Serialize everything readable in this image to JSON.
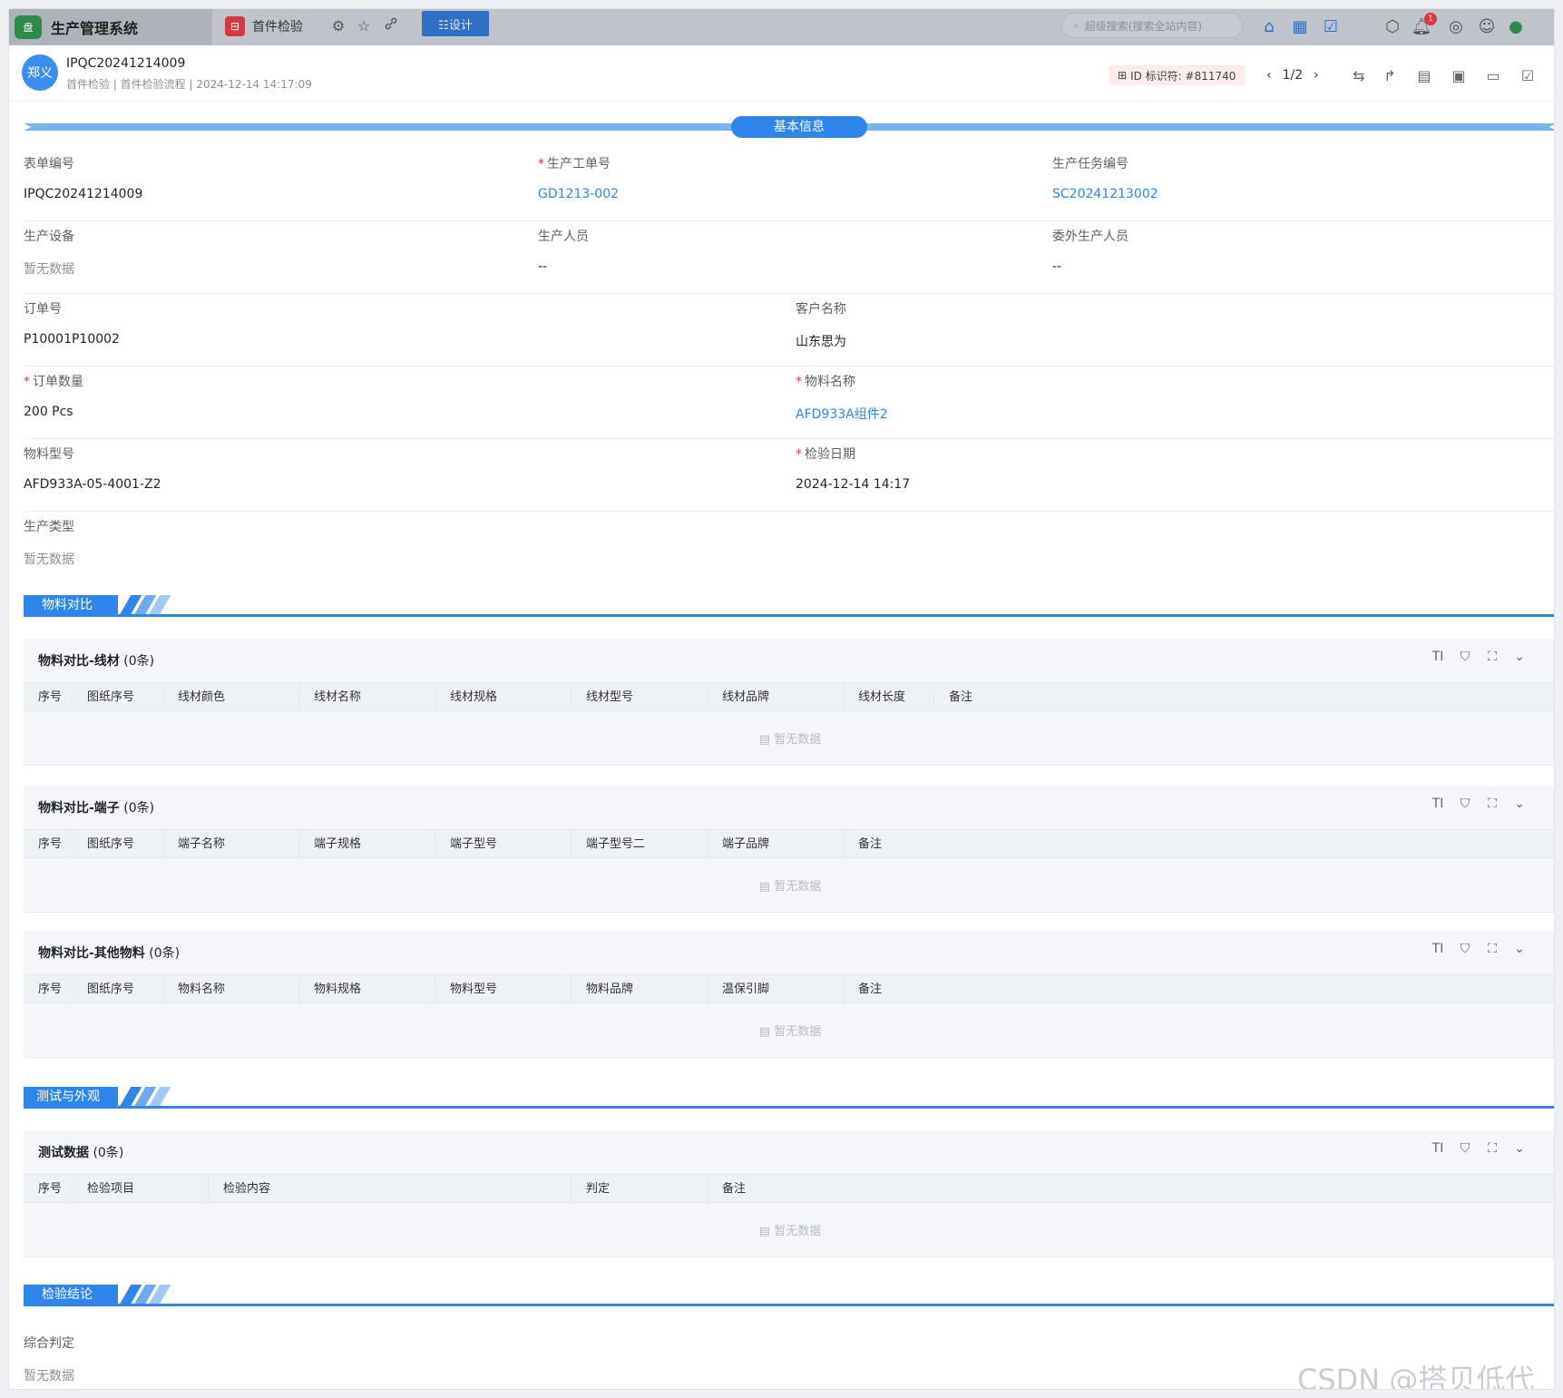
{
  "topbar": {
    "logo_text": "盘",
    "app_title": "生产管理系统",
    "tab_label": "首件检验",
    "tab_icon_text": "⊟",
    "design_label": "☷设计",
    "search_placeholder": "超级搜索(搜索全站内容)",
    "notification_count": "1"
  },
  "header": {
    "avatar_text": "郑义",
    "record_id": "IPQC20241214009",
    "subtitle": "首件检验 | 首件检验流程 | 2024-12-14 14:17:09",
    "id_chip": "ID 标识符: #811740",
    "page_indicator": "1/2"
  },
  "basic_section": {
    "title": "基本信息"
  },
  "fields": {
    "form_no": {
      "label": "表单编号",
      "value": "IPQC20241214009"
    },
    "work_order": {
      "label": "生产工单号",
      "value": "GD1213-002"
    },
    "task_no": {
      "label": "生产任务编号",
      "value": "SC20241213002"
    },
    "equipment": {
      "label": "生产设备",
      "value": "暂无数据"
    },
    "personnel": {
      "label": "生产人员",
      "value": "--"
    },
    "outsourced": {
      "label": "委外生产人员",
      "value": "--"
    },
    "order_no": {
      "label": "订单号",
      "value": "P10001P10002"
    },
    "customer": {
      "label": "客户名称",
      "value": "山东思为"
    },
    "order_qty": {
      "label": "订单数量",
      "value": "200 Pcs"
    },
    "material_name": {
      "label": "物料名称",
      "value": "AFD933A组件2"
    },
    "material_model": {
      "label": "物料型号",
      "value": "AFD933A-05-4001-Z2"
    },
    "inspect_date": {
      "label": "检验日期",
      "value": "2024-12-14 14:17"
    },
    "production_type": {
      "label": "生产类型",
      "value": "暂无数据"
    }
  },
  "sections": {
    "material_compare": "物料对比",
    "test_appearance": "测试与外观",
    "conclusion": "检验结论"
  },
  "tables": {
    "wire": {
      "title": "物料对比-线材",
      "count": "(0条)",
      "columns": [
        "序号",
        "图纸序号",
        "线材颜色",
        "线材名称",
        "线材规格",
        "线材型号",
        "线材品牌",
        "线材长度",
        "备注"
      ]
    },
    "terminal": {
      "title": "物料对比-端子",
      "count": "(0条)",
      "columns": [
        "序号",
        "图纸序号",
        "端子名称",
        "端子规格",
        "端子型号",
        "端子型号二",
        "端子品牌",
        "备注"
      ]
    },
    "other": {
      "title": "物料对比-其他物料",
      "count": "(0条)",
      "columns": [
        "序号",
        "图纸序号",
        "物料名称",
        "物料规格",
        "物料型号",
        "物料品牌",
        "温保引脚",
        "备注"
      ]
    },
    "test": {
      "title": "测试数据",
      "count": "(0条)",
      "columns": [
        "序号",
        "检验项目",
        "检验内容",
        "判定",
        "备注"
      ]
    }
  },
  "empty_text": "暂无数据",
  "conclusion": {
    "label": "综合判定",
    "value": "暂无数据"
  },
  "watermark": "CSDN @搭贝低代码"
}
